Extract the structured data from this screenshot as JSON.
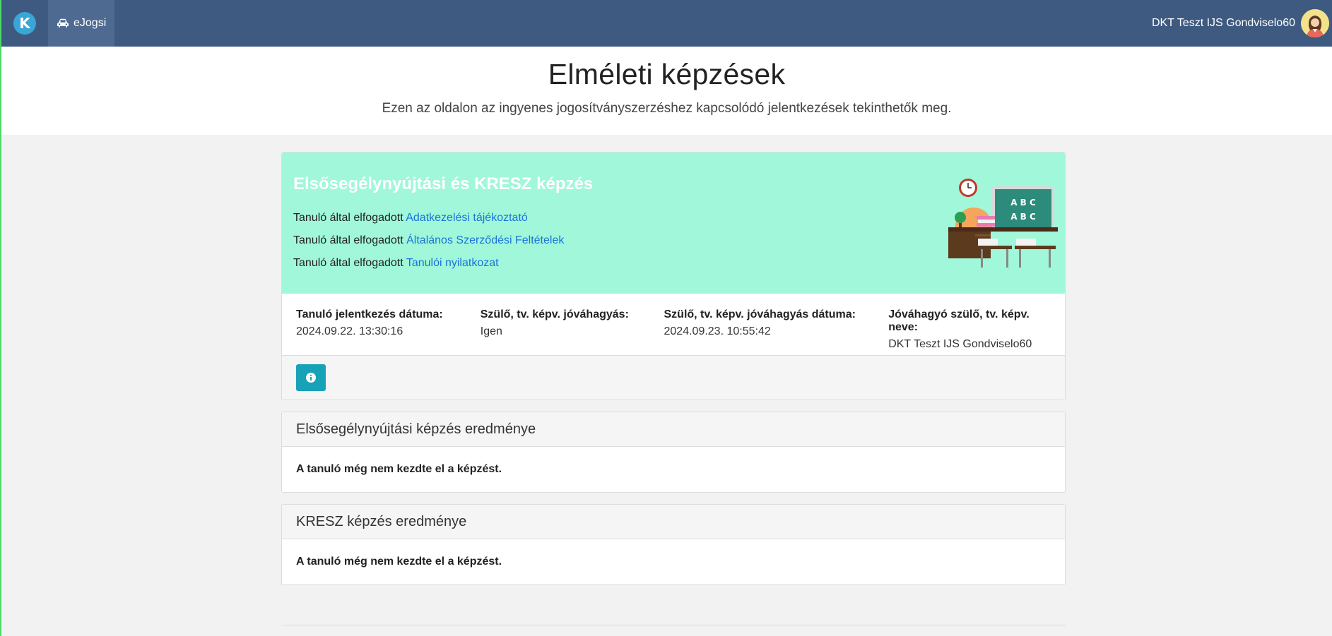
{
  "navbar": {
    "logo_letter": "K",
    "nav_item_label": "eJogsi",
    "user_name": "DKT Teszt IJS Gondviselo60"
  },
  "header": {
    "title": "Elméleti képzések",
    "subtitle": "Ezen az oldalon az ingyenes jogosítványszerzéshez kapcsolódó jelentkezések tekinthetők meg."
  },
  "course": {
    "title": "Elsősegélynyújtási és KRESZ képzés",
    "accepted_prefix": "Tanuló által elfogadott",
    "links": [
      "Adatkezelési tájékoztató",
      "Általános Szerződési Feltételek",
      "Tanulói nyilatkozat"
    ],
    "board_text": [
      "A B C",
      "A B C"
    ],
    "details": [
      {
        "label": "Tanuló jelentkezés dátuma:",
        "value": "2024.09.22. 13:30:16"
      },
      {
        "label": "Szülő, tv. képv. jóváhagyás:",
        "value": "Igen"
      },
      {
        "label": "Szülő, tv. képv. jóváhagyás dátuma:",
        "value": "2024.09.23. 10:55:42"
      },
      {
        "label": "Jóváhagyó szülő, tv. képv. neve:",
        "value": "DKT Teszt IJS Gondviselo60"
      }
    ]
  },
  "results": [
    {
      "title": "Elsősegélynyújtási képzés eredménye",
      "text": "A tanuló még nem kezdte el a képzést."
    },
    {
      "title": "KRESZ képzés eredménye",
      "text": "A tanuló még nem kezdte el a képzést."
    }
  ],
  "colors": {
    "navbar": "#3e5a80",
    "hero_bg": "#a0f7d9",
    "link": "#1a73d9",
    "info_button": "#17a2b8"
  }
}
